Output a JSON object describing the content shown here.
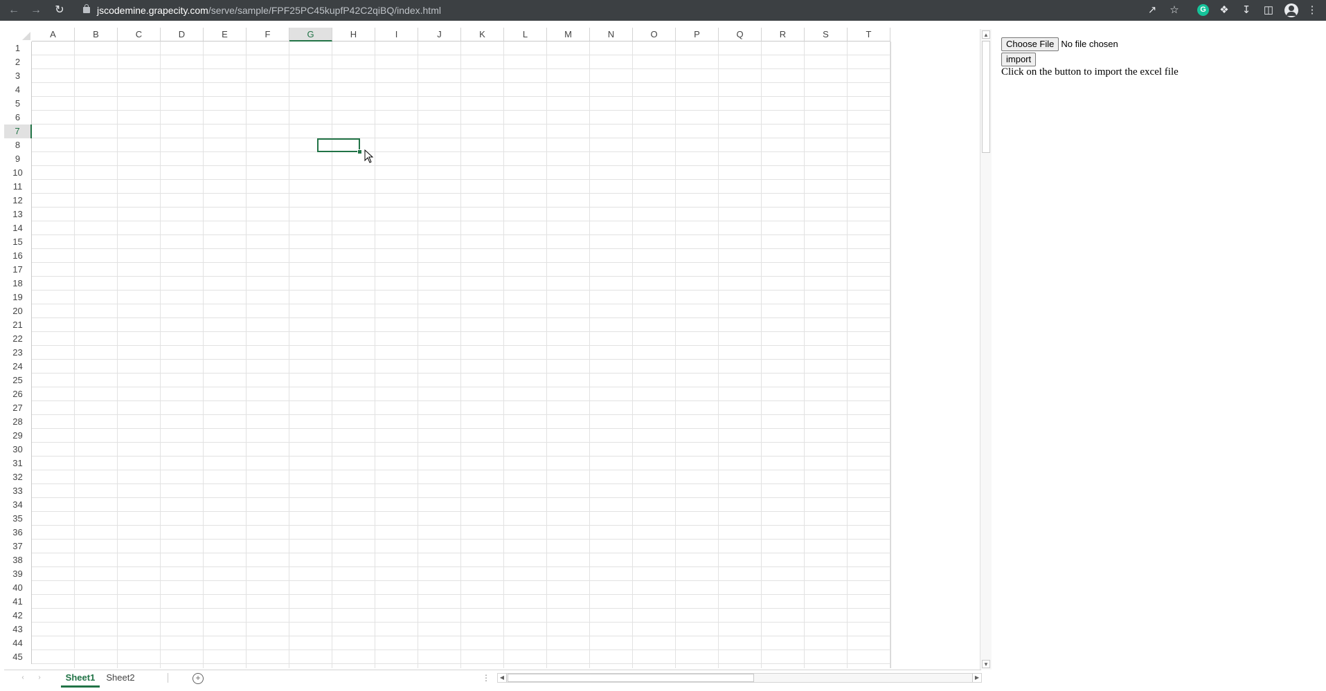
{
  "browser": {
    "url_host": "jscodemine.grapecity.com",
    "url_path": "/serve/sample/FPF25PC45kupfP42C2qiBQ/index.html",
    "extension_g_label": "G"
  },
  "spreadsheet": {
    "columns": [
      "A",
      "B",
      "C",
      "D",
      "E",
      "F",
      "G",
      "H",
      "I",
      "J",
      "K",
      "L",
      "M",
      "N",
      "O",
      "P",
      "Q",
      "R",
      "S",
      "T"
    ],
    "rows": [
      "1",
      "2",
      "3",
      "4",
      "5",
      "6",
      "7",
      "8",
      "9",
      "10",
      "11",
      "12",
      "13",
      "14",
      "15",
      "16",
      "17",
      "18",
      "19",
      "20",
      "21",
      "22",
      "23",
      "24",
      "25",
      "26",
      "27",
      "28",
      "29",
      "30",
      "31",
      "32",
      "33",
      "34",
      "35",
      "36",
      "37",
      "38",
      "39",
      "40",
      "41",
      "42",
      "43",
      "44",
      "45"
    ],
    "active_column": "G",
    "active_row": "7",
    "accent_color": "#217346"
  },
  "tabs": {
    "sheets": [
      "Sheet1",
      "Sheet2"
    ],
    "active": "Sheet1"
  },
  "panel": {
    "choose_file_label": "Choose File",
    "file_status": "No file chosen",
    "import_label": "import",
    "help_text": "Click on the button to import the excel file"
  }
}
